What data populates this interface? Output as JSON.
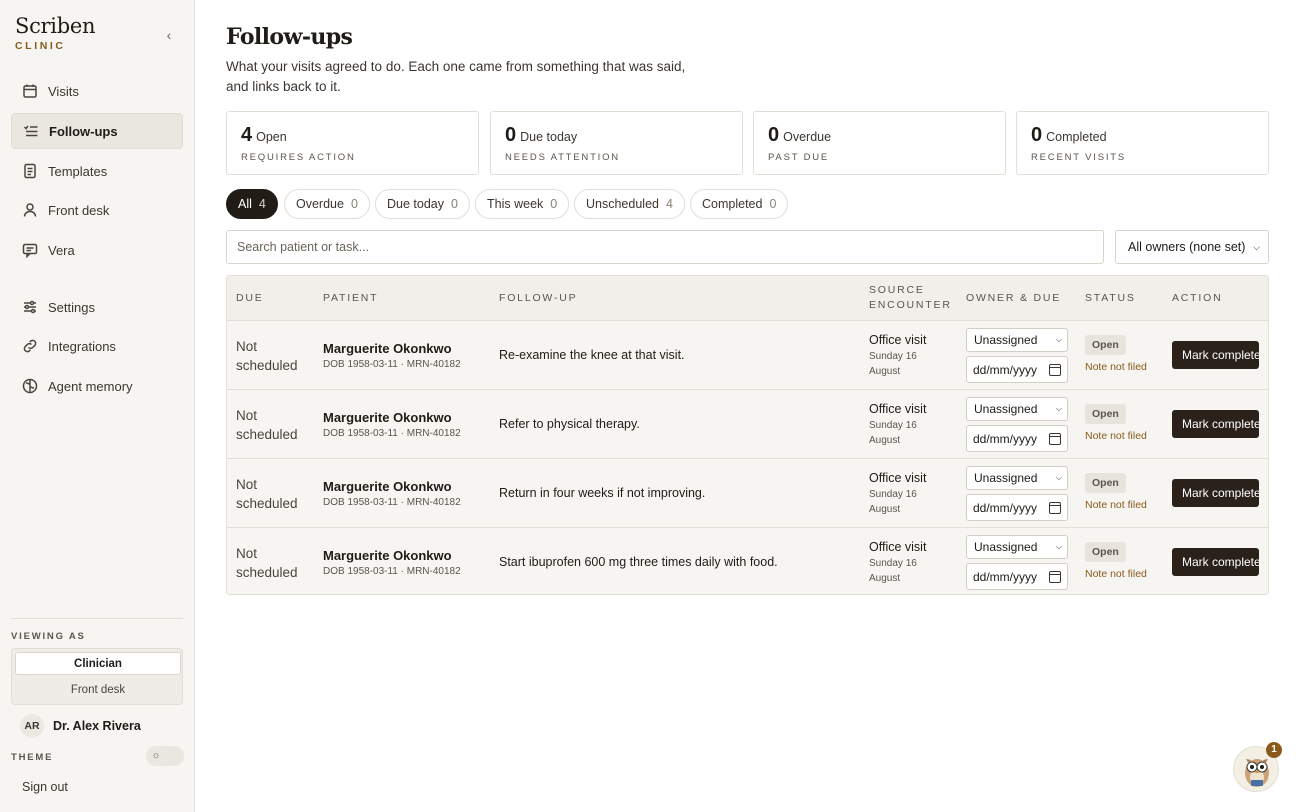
{
  "brand": {
    "name": "Scriben",
    "sub": "CLINIC"
  },
  "nav": [
    {
      "label": "Visits",
      "icon": "calendar-icon"
    },
    {
      "label": "Follow-ups",
      "icon": "list-check-icon",
      "active": true
    },
    {
      "label": "Templates",
      "icon": "document-icon"
    },
    {
      "label": "Front desk",
      "icon": "user-icon"
    },
    {
      "label": "Vera",
      "icon": "chat-icon"
    },
    {
      "label": "Settings",
      "icon": "sliders-icon"
    },
    {
      "label": "Integrations",
      "icon": "link-icon"
    },
    {
      "label": "Agent memory",
      "icon": "brain-icon"
    }
  ],
  "viewing_as": {
    "label": "VIEWING AS",
    "options": [
      "Clinician",
      "Front desk"
    ],
    "selected": "Clinician"
  },
  "user": {
    "initials": "AR",
    "name": "Dr. Alex Rivera"
  },
  "theme": {
    "label": "THEME",
    "icon": "sun-icon"
  },
  "signout": "Sign out",
  "page": {
    "title": "Follow-ups",
    "description": "What your visits agreed to do. Each one came from something that was said, and links back to it."
  },
  "stats": [
    {
      "value": "4",
      "label": "Open",
      "sub": "REQUIRES ACTION"
    },
    {
      "value": "0",
      "label": "Due today",
      "sub": "NEEDS ATTENTION"
    },
    {
      "value": "0",
      "label": "Overdue",
      "sub": "PAST DUE"
    },
    {
      "value": "0",
      "label": "Completed",
      "sub": "RECENT VISITS"
    }
  ],
  "filters": [
    {
      "label": "All",
      "count": "4",
      "active": true
    },
    {
      "label": "Overdue",
      "count": "0"
    },
    {
      "label": "Due today",
      "count": "0"
    },
    {
      "label": "This week",
      "count": "0"
    },
    {
      "label": "Unscheduled",
      "count": "4"
    },
    {
      "label": "Completed",
      "count": "0"
    }
  ],
  "search": {
    "placeholder": "Search patient or task...",
    "value": ""
  },
  "owner_filter": {
    "value": "All owners (none set)"
  },
  "table": {
    "headers": {
      "due": "DUE",
      "patient": "PATIENT",
      "followup": "FOLLOW-UP",
      "source1": "SOURCE",
      "source2": "ENCOUNTER",
      "owner": "OWNER & DUE",
      "status": "STATUS",
      "action": "ACTION"
    },
    "rows": [
      {
        "due1": "Not",
        "due2": "scheduled",
        "patient": "Marguerite Okonkwo",
        "meta": "DOB 1958-03-11 · MRN-40182",
        "task": "Re-examine the knee at that visit.",
        "source": "Office visit",
        "source_date": "Sunday 16 August",
        "owner": "Unassigned",
        "date_placeholder": "dd/mm/yyyy",
        "status": "Open",
        "note": "Note not filed",
        "action": "Mark complete"
      },
      {
        "due1": "Not",
        "due2": "scheduled",
        "patient": "Marguerite Okonkwo",
        "meta": "DOB 1958-03-11 · MRN-40182",
        "task": "Refer to physical therapy.",
        "source": "Office visit",
        "source_date": "Sunday 16 August",
        "owner": "Unassigned",
        "date_placeholder": "dd/mm/yyyy",
        "status": "Open",
        "note": "Note not filed",
        "action": "Mark complete"
      },
      {
        "due1": "Not",
        "due2": "scheduled",
        "patient": "Marguerite Okonkwo",
        "meta": "DOB 1958-03-11 · MRN-40182",
        "task": "Return in four weeks if not improving.",
        "source": "Office visit",
        "source_date": "Sunday 16 August",
        "owner": "Unassigned",
        "date_placeholder": "dd/mm/yyyy",
        "status": "Open",
        "note": "Note not filed",
        "action": "Mark complete"
      },
      {
        "due1": "Not",
        "due2": "scheduled",
        "patient": "Marguerite Okonkwo",
        "meta": "DOB 1958-03-11 · MRN-40182",
        "task": "Start ibuprofen 600 mg three times daily with food.",
        "source": "Office visit",
        "source_date": "Sunday 16 August",
        "owner": "Unassigned",
        "date_placeholder": "dd/mm/yyyy",
        "status": "Open",
        "note": "Note not filed",
        "action": "Mark complete"
      }
    ]
  },
  "assistant": {
    "badge": "1",
    "icon": "owl-mascot-icon"
  }
}
